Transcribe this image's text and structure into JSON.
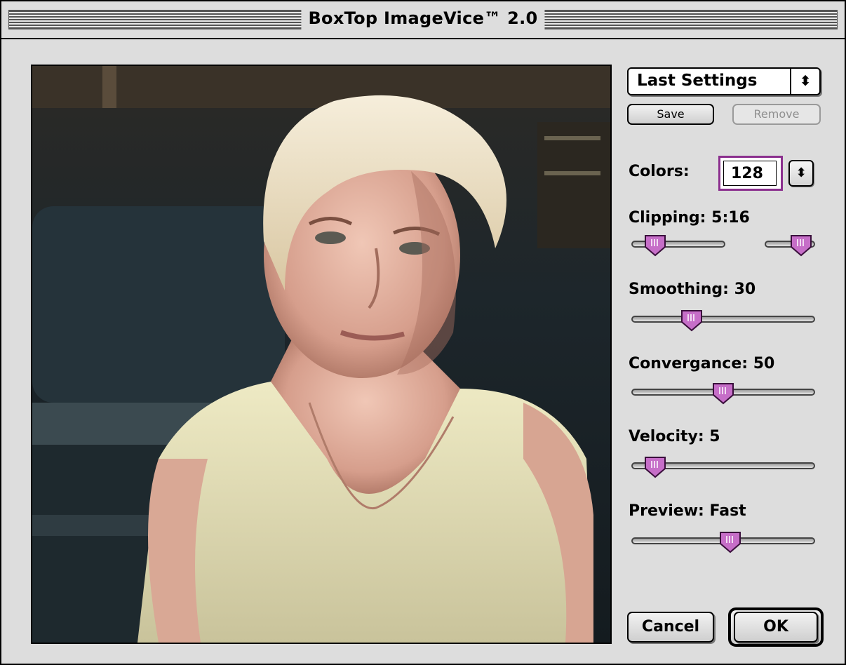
{
  "window": {
    "title": "BoxTop ImageVice™ 2.0"
  },
  "preview": {
    "description_icon": "photo-preview"
  },
  "settings_popup": {
    "label": "Last Settings",
    "arrows": "⬍"
  },
  "buttons": {
    "save": "Save",
    "remove": "Remove",
    "cancel": "Cancel",
    "ok": "OK"
  },
  "colors": {
    "label": "Colors:",
    "value": "128",
    "stepper": "⬍"
  },
  "clipping": {
    "label": "Clipping: 5:16",
    "low": 5,
    "high": 16
  },
  "smoothing": {
    "label": "Smoothing: 30",
    "value": 30
  },
  "convergance": {
    "label": "Convergance: 50",
    "value": 50
  },
  "velocity": {
    "label": "Velocity: 5",
    "value": 5
  },
  "preview_speed": {
    "label": "Preview: Fast",
    "value": "Fast"
  },
  "colors_theme": {
    "accent": "#c66ec8",
    "accent_dark": "#6b1f6e",
    "field_ring": "#8b2f8e"
  }
}
